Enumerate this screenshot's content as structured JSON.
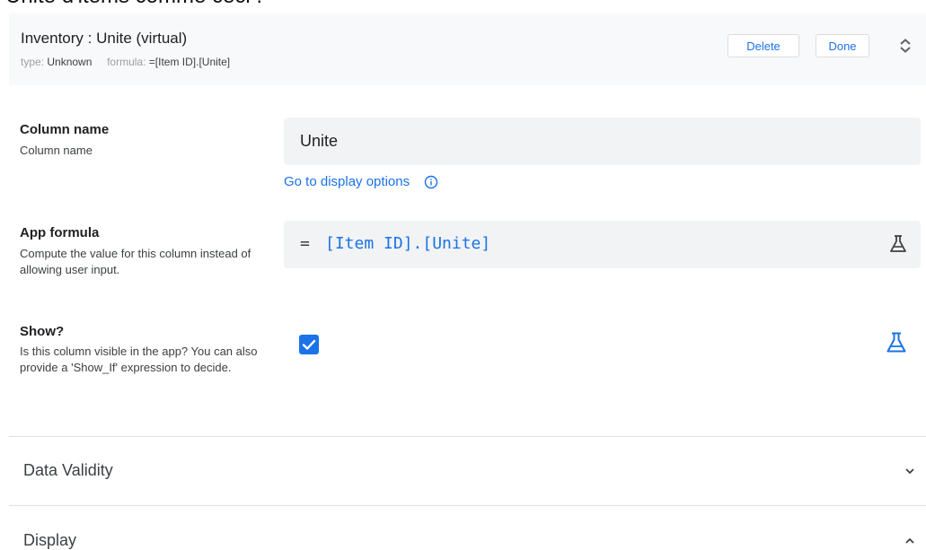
{
  "cropped_caption": "Unite d'items comme ceci :",
  "header": {
    "title": "Inventory : Unite (virtual)",
    "type_label": "type:",
    "type_value": "Unknown",
    "formula_label": "formula:",
    "formula_value": "=[Item ID].[Unite]",
    "delete_label": "Delete",
    "done_label": "Done",
    "expand_icon": "unfold-more-icon"
  },
  "column_name": {
    "title": "Column name",
    "description": "Column name",
    "value": "Unite",
    "display_link": "Go to display options",
    "info_icon": "info-icon"
  },
  "app_formula": {
    "title": "App formula",
    "description": "Compute the value for this column instead of allowing user input.",
    "equals": "=",
    "expression": "[Item ID].[Unite]",
    "test_icon": "flask-icon"
  },
  "show": {
    "title": "Show?",
    "description": "Is this column visible in the app? You can also provide a 'Show_If' expression to decide.",
    "checked": true,
    "test_icon": "flask-icon"
  },
  "sections": [
    {
      "label": "Data Validity",
      "state": "collapsed"
    },
    {
      "label": "Display",
      "state": "expanded"
    }
  ],
  "colors": {
    "accent": "#1a73e8",
    "header_bg": "#f8f9fa",
    "field_bg": "#f1f3f4"
  }
}
